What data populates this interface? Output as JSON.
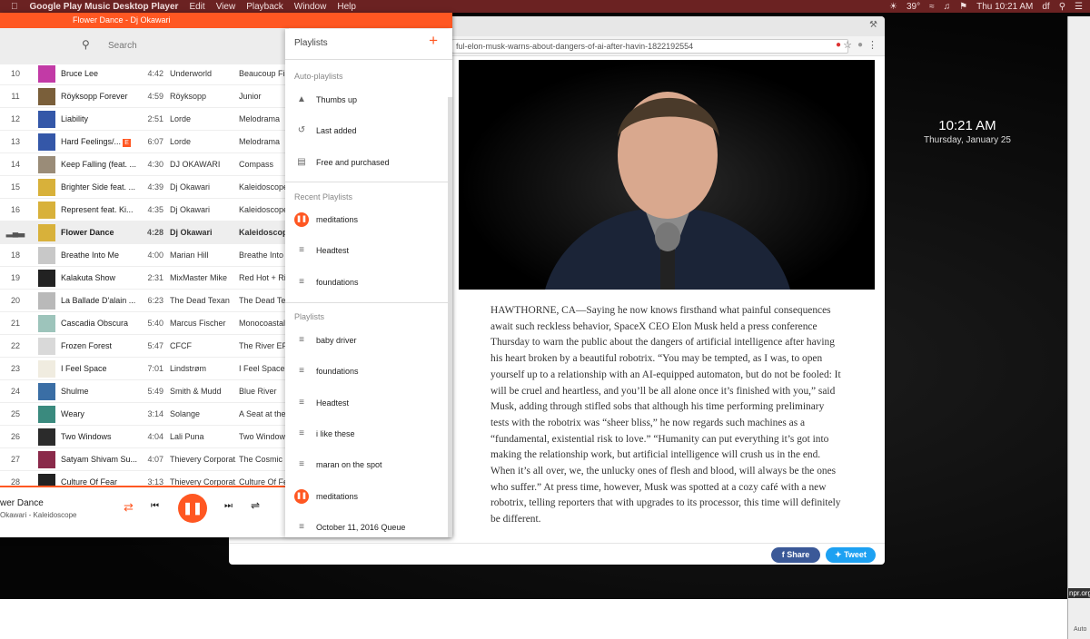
{
  "menubar": {
    "app": "Google Play Music Desktop Player",
    "menus": [
      "Edit",
      "View",
      "Playback",
      "Window",
      "Help"
    ],
    "temp": "39°",
    "datetime": "Thu 10:21 AM",
    "user": "df"
  },
  "desktop": {
    "time": "10:21 AM",
    "date": "Thursday, January 25",
    "side_label": "npr.org",
    "side_label2": "Auto"
  },
  "gpm": {
    "title": "Flower Dance - Dj Okawari",
    "search_placeholder": "Search",
    "tracks": [
      {
        "num": "10",
        "title": "Bruce Lee",
        "duration": "4:42",
        "artist": "Underworld",
        "album": "Beaucoup Fish",
        "art": "#c23aa6"
      },
      {
        "num": "11",
        "title": "Röyksopp Forever",
        "duration": "4:59",
        "artist": "Röyksopp",
        "album": "Junior",
        "art": "#7a5f3a"
      },
      {
        "num": "12",
        "title": "Liability",
        "duration": "2:51",
        "artist": "Lorde",
        "album": "Melodrama",
        "art": "#3457a8"
      },
      {
        "num": "13",
        "title": "Hard Feelings/...",
        "explicit": "E",
        "duration": "6:07",
        "artist": "Lorde",
        "album": "Melodrama",
        "art": "#3457a8"
      },
      {
        "num": "14",
        "title": "Keep Falling (feat. ...",
        "duration": "4:30",
        "artist": "DJ OKAWARI",
        "album": "Compass",
        "art": "#9a8c78"
      },
      {
        "num": "15",
        "title": "Brighter Side feat. ...",
        "duration": "4:39",
        "artist": "Dj Okawari",
        "album": "Kaleidoscope",
        "art": "#d8b13a"
      },
      {
        "num": "16",
        "title": "Represent feat. Ki...",
        "duration": "4:35",
        "artist": "Dj Okawari",
        "album": "Kaleidoscope",
        "art": "#d8b13a"
      },
      {
        "num": "",
        "title": "Flower Dance",
        "duration": "4:28",
        "artist": "Dj Okawari",
        "album": "Kaleidoscope",
        "art": "#d8b13a",
        "current": true
      },
      {
        "num": "18",
        "title": "Breathe Into Me",
        "duration": "4:00",
        "artist": "Marian Hill",
        "album": "Breathe Into Me",
        "art": "#c8c8c8"
      },
      {
        "num": "19",
        "title": "Kalakuta Show",
        "duration": "2:31",
        "artist": "MixMaster Mike",
        "album": "Red Hot + Rio",
        "art": "#222222"
      },
      {
        "num": "20",
        "title": "La Ballade D'alain ...",
        "duration": "6:23",
        "artist": "The Dead Texan",
        "album": "The Dead Texan",
        "art": "#b9b9b9"
      },
      {
        "num": "21",
        "title": "Cascadia Obscura",
        "duration": "5:40",
        "artist": "Marcus Fischer",
        "album": "Monocoastal",
        "art": "#9dc4bb"
      },
      {
        "num": "22",
        "title": "Frozen Forest",
        "duration": "5:47",
        "artist": "CFCF",
        "album": "The River EP",
        "art": "#d9d9d9"
      },
      {
        "num": "23",
        "title": "I Feel Space",
        "duration": "7:01",
        "artist": "Lindstrøm",
        "album": "I Feel Space",
        "art": "#f0ece0"
      },
      {
        "num": "24",
        "title": "Shulme",
        "duration": "5:49",
        "artist": "Smith & Mudd",
        "album": "Blue River",
        "art": "#3a6ea5"
      },
      {
        "num": "25",
        "title": "Weary",
        "duration": "3:14",
        "artist": "Solange",
        "album": "A Seat at the Table",
        "art": "#3a8a7e"
      },
      {
        "num": "26",
        "title": "Two Windows",
        "duration": "4:04",
        "artist": "Lali Puna",
        "album": "Two Windows",
        "art": "#2b2b2b"
      },
      {
        "num": "27",
        "title": "Satyam Shivam Su...",
        "duration": "4:07",
        "artist": "Thievery Corporat...",
        "album": "The Cosmic Game",
        "art": "#8a2a4a"
      },
      {
        "num": "28",
        "title": "Culture Of Fear",
        "duration": "3:13",
        "artist": "Thievery Corporat...",
        "album": "Culture Of Fear",
        "art": "#222222"
      }
    ],
    "now_playing": {
      "title": "wer Dance",
      "subtitle": "Okawari - Kaleidoscope"
    },
    "accent": "#ff5722"
  },
  "panel": {
    "heading": "Playlists",
    "auto_header": "Auto-playlists",
    "auto": [
      {
        "label": "Thumbs up",
        "icon": "thumbs-up-icon"
      },
      {
        "label": "Last added",
        "icon": "history-icon"
      },
      {
        "label": "Free and purchased",
        "icon": "library-icon"
      }
    ],
    "recent_header": "Recent Playlists",
    "recent": [
      {
        "label": "meditations",
        "icon": "playing-icon"
      },
      {
        "label": "Headtest",
        "icon": "playlist-icon"
      },
      {
        "label": "foundations",
        "icon": "playlist-icon"
      }
    ],
    "playlists_header": "Playlists",
    "playlists": [
      {
        "label": "baby driver",
        "icon": "playlist-icon"
      },
      {
        "label": "foundations",
        "icon": "playlist-icon"
      },
      {
        "label": "Headtest",
        "icon": "playlist-icon"
      },
      {
        "label": "i like these",
        "icon": "playlist-icon"
      },
      {
        "label": "maran on the spot",
        "icon": "playlist-icon"
      },
      {
        "label": "meditations",
        "icon": "playing-icon"
      },
      {
        "label": "October 11, 2016 Queue",
        "icon": "playlist-icon"
      }
    ]
  },
  "browser": {
    "url": "ful-elon-musk-warns-about-dangers-of-ai-after-havin-1822192554",
    "article": "HAWTHORNE, CA—Saying he now knows firsthand what painful consequences await such reckless behavior, SpaceX CEO Elon Musk held a press conference Thursday to warn the public about the dangers of artificial intelligence after having his heart broken by a beautiful robotrix. “You may be tempted, as I was, to open yourself up to a relationship with an AI-equipped automaton, but do not be fooled: It will be cruel and heartless, and you’ll be all alone once it’s finished with you,” said Musk, adding through stifled sobs that although his time performing preliminary tests with the robotrix was “sheer bliss,” he now regards such machines as a “fundamental, existential risk to love.” “Humanity can put everything it’s got into making the relationship work, but artificial intelligence will crush us in the end. When it’s all over, we, the unlucky ones of flesh and blood, will always be the ones who suffer.” At press time, however, Musk was spotted at a cozy café with a new robotrix, telling reporters that with upgrades to its processor, this time will definitely be different.",
    "share_label": "Share",
    "tweet_label": "Tweet",
    "share_color": "#3b5998",
    "tweet_color": "#1da1f2"
  }
}
